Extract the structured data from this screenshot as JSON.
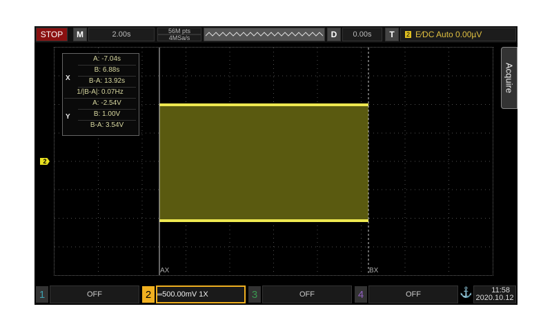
{
  "top": {
    "run_state": "STOP",
    "menu_btn": "M",
    "timebase": "2.00s",
    "mem_depth": "56M pts",
    "sample_rate": "4MSa/s",
    "delay_btn": "D",
    "delay": "0.00s",
    "trigger_btn": "T",
    "trigger_channel": "2",
    "trigger_info": "E∕DC Auto 0.00µV"
  },
  "measure": {
    "x_label": "X",
    "y_label": "Y",
    "rows": [
      "A: -7.04s",
      "B: 6.88s",
      "B-A: 13.92s",
      "1/|B-A|: 0.07Hz",
      "A: -2.54V",
      "B: 1.00V",
      "B-A: 3.54V"
    ]
  },
  "side_tab": "Acquire",
  "cursors": {
    "a": "AX",
    "b": "BX"
  },
  "ch_marker": "2",
  "channels": [
    {
      "num": "1",
      "status": "OFF",
      "color": "#3fa0b0"
    },
    {
      "num": "2",
      "status": "500.00mV 1X",
      "color": "#f0b020"
    },
    {
      "num": "3",
      "status": "OFF",
      "color": "#3a9a50"
    },
    {
      "num": "4",
      "status": "OFF",
      "color": "#9060c0"
    }
  ],
  "clock": {
    "time": "11:58",
    "date": "2020.10.12"
  },
  "colors": {
    "trace": "#e8e040",
    "stop": "#a01010"
  }
}
